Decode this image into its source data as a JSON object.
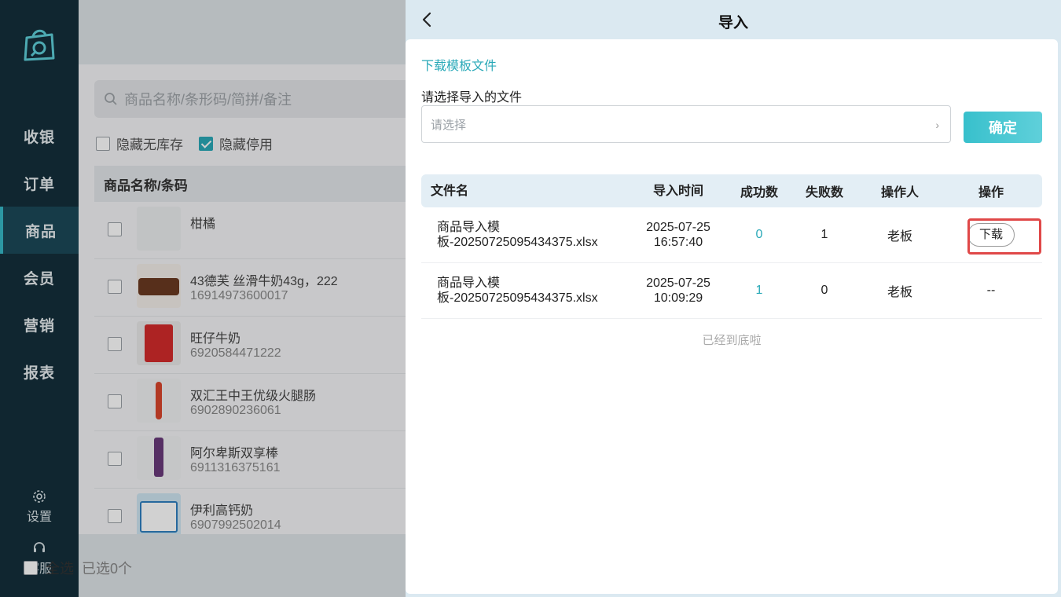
{
  "sidebar": {
    "items": [
      {
        "label": "收银"
      },
      {
        "label": "订单"
      },
      {
        "label": "商品"
      },
      {
        "label": "会员"
      },
      {
        "label": "营销"
      },
      {
        "label": "报表"
      }
    ],
    "active": "商品",
    "settings_label": "设置",
    "service_label": "客服"
  },
  "main": {
    "search_placeholder": "商品名称/条形码/简拼/备注",
    "filters": [
      {
        "label": "隐藏无库存",
        "checked": false
      },
      {
        "label": "隐藏停用",
        "checked": true
      }
    ],
    "column_header": "商品名称/条码",
    "products": [
      {
        "name": "柑橘",
        "code": ""
      },
      {
        "name": "43德芙 丝滑牛奶43g，222",
        "code": "16914973600017"
      },
      {
        "name": "旺仔牛奶",
        "code": "6920584471222"
      },
      {
        "name": "双汇王中王优级火腿肠",
        "code": "6902890236061"
      },
      {
        "name": "阿尔卑斯双享棒",
        "code": "6911316375161"
      },
      {
        "name": "伊利高钙奶",
        "code": "6907992502014"
      }
    ],
    "select_all_label": "全选",
    "selected_count": "已选0个"
  },
  "drawer": {
    "title": "导入",
    "download_template_link": "下载模板文件",
    "select_label": "请选择导入的文件",
    "select_placeholder": "请选择",
    "confirm_label": "确定",
    "table": {
      "headers": [
        "文件名",
        "导入时间",
        "成功数",
        "失败数",
        "操作人",
        "操作"
      ],
      "rows": [
        {
          "file_line1": "商品导入模",
          "file_line2": "板-20250725095434375.xlsx",
          "date": "2025-07-25",
          "time": "16:57:40",
          "success": "0",
          "fail": "1",
          "operator": "老板",
          "action": "下载"
        },
        {
          "file_line1": "商品导入模",
          "file_line2": "板-20250725095434375.xlsx",
          "date": "2025-07-25",
          "time": "10:09:29",
          "success": "1",
          "fail": "0",
          "operator": "老板",
          "action": "--"
        }
      ]
    },
    "end_note": "已经到底啦"
  },
  "colors": {
    "sidebar_bg": "#142f3b",
    "accent": "#2aa9b8",
    "highlight": "#e04848"
  }
}
